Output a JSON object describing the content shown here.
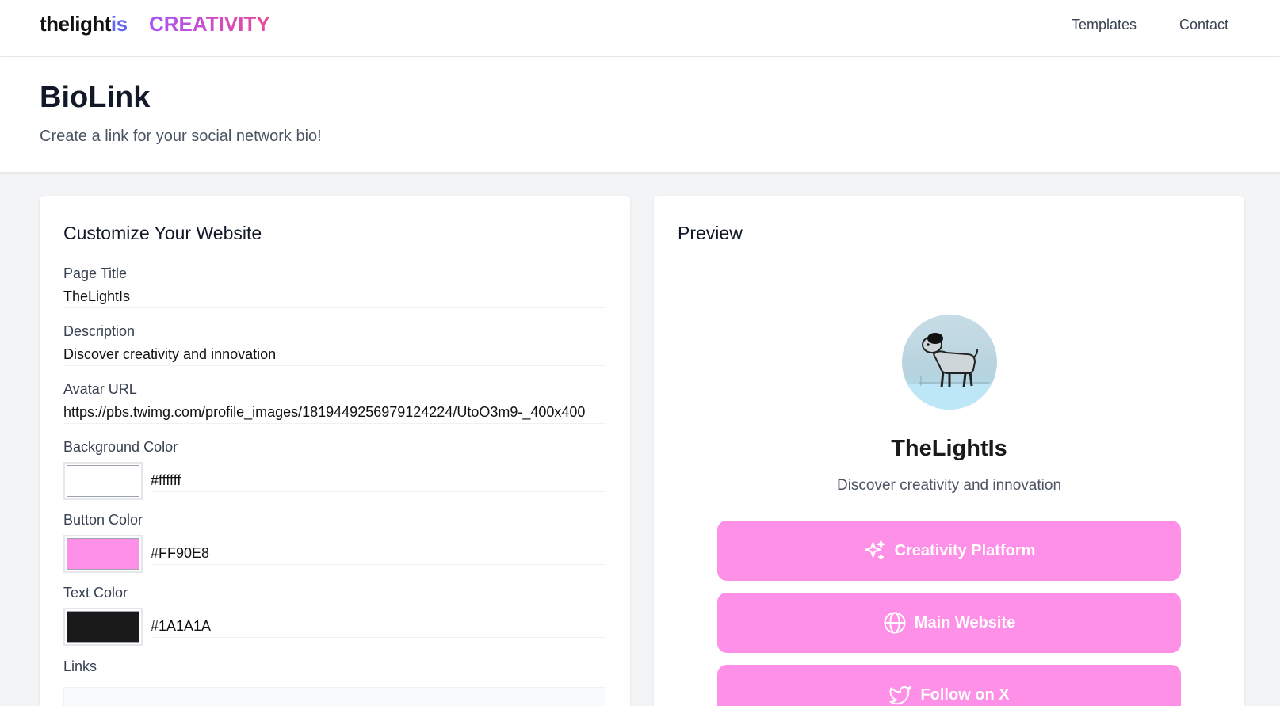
{
  "nav": {
    "brand_part1": "thelight",
    "brand_part2": "is",
    "section": "CREATIVITY",
    "links": [
      "Templates",
      "Contact"
    ]
  },
  "hero": {
    "title": "BioLink",
    "subtitle": "Create a link for your social network bio!"
  },
  "editor": {
    "heading": "Customize Your Website",
    "fields": {
      "page_title": {
        "label": "Page Title",
        "value": "TheLightIs"
      },
      "description": {
        "label": "Description",
        "value": "Discover creativity and innovation"
      },
      "avatar_url": {
        "label": "Avatar URL",
        "value": "https://pbs.twimg.com/profile_images/1819449256979124224/UtoO3m9-_400x400"
      },
      "background_color": {
        "label": "Background Color",
        "value": "#ffffff"
      },
      "button_color": {
        "label": "Button Color",
        "value": "#FF90E8"
      },
      "text_color": {
        "label": "Text Color",
        "value": "#1A1A1A"
      }
    },
    "links_label": "Links"
  },
  "preview": {
    "heading": "Preview",
    "title": "TheLightIs",
    "description": "Discover creativity and innovation",
    "buttons": [
      {
        "label": "Creativity Platform",
        "icon": "sparkles-icon"
      },
      {
        "label": "Main Website",
        "icon": "globe-icon"
      },
      {
        "label": "Follow on X",
        "icon": "twitter-icon"
      }
    ]
  },
  "colors": {
    "brand_accent": "#6366f1",
    "creativity_gradient_start": "#a855f7",
    "creativity_gradient_end": "#ec4899",
    "button": "#FF90E8",
    "text": "#1A1A1A",
    "background": "#ffffff"
  }
}
